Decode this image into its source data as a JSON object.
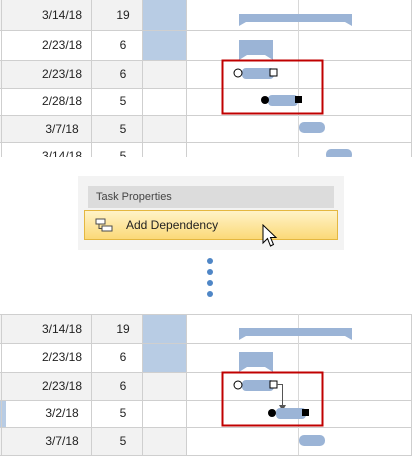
{
  "before": {
    "rows": [
      {
        "date": "3/14/18",
        "duration": "19"
      },
      {
        "date": "2/23/18",
        "duration": "6"
      },
      {
        "date": "2/23/18",
        "duration": "6"
      },
      {
        "date": "2/28/18",
        "duration": "5"
      },
      {
        "date": "3/7/18",
        "duration": "5"
      },
      {
        "date": "3/14/18",
        "duration": "5"
      }
    ]
  },
  "menu": {
    "header": "Task Properties",
    "item_label": "Add Dependency",
    "item_icon": "dependency-icon"
  },
  "after": {
    "rows": [
      {
        "date": "3/14/18",
        "duration": "19"
      },
      {
        "date": "2/23/18",
        "duration": "6"
      },
      {
        "date": "2/23/18",
        "duration": "6"
      },
      {
        "date": "3/2/18",
        "duration": "5"
      },
      {
        "date": "3/7/18",
        "duration": "5"
      }
    ]
  },
  "colors": {
    "grid_line": "#cfcfcf",
    "bar_fill": "#9bb4d6",
    "shaded_column": "#b8cce4",
    "highlight_box": "#c00000",
    "menu_hover": "#fbd978"
  }
}
